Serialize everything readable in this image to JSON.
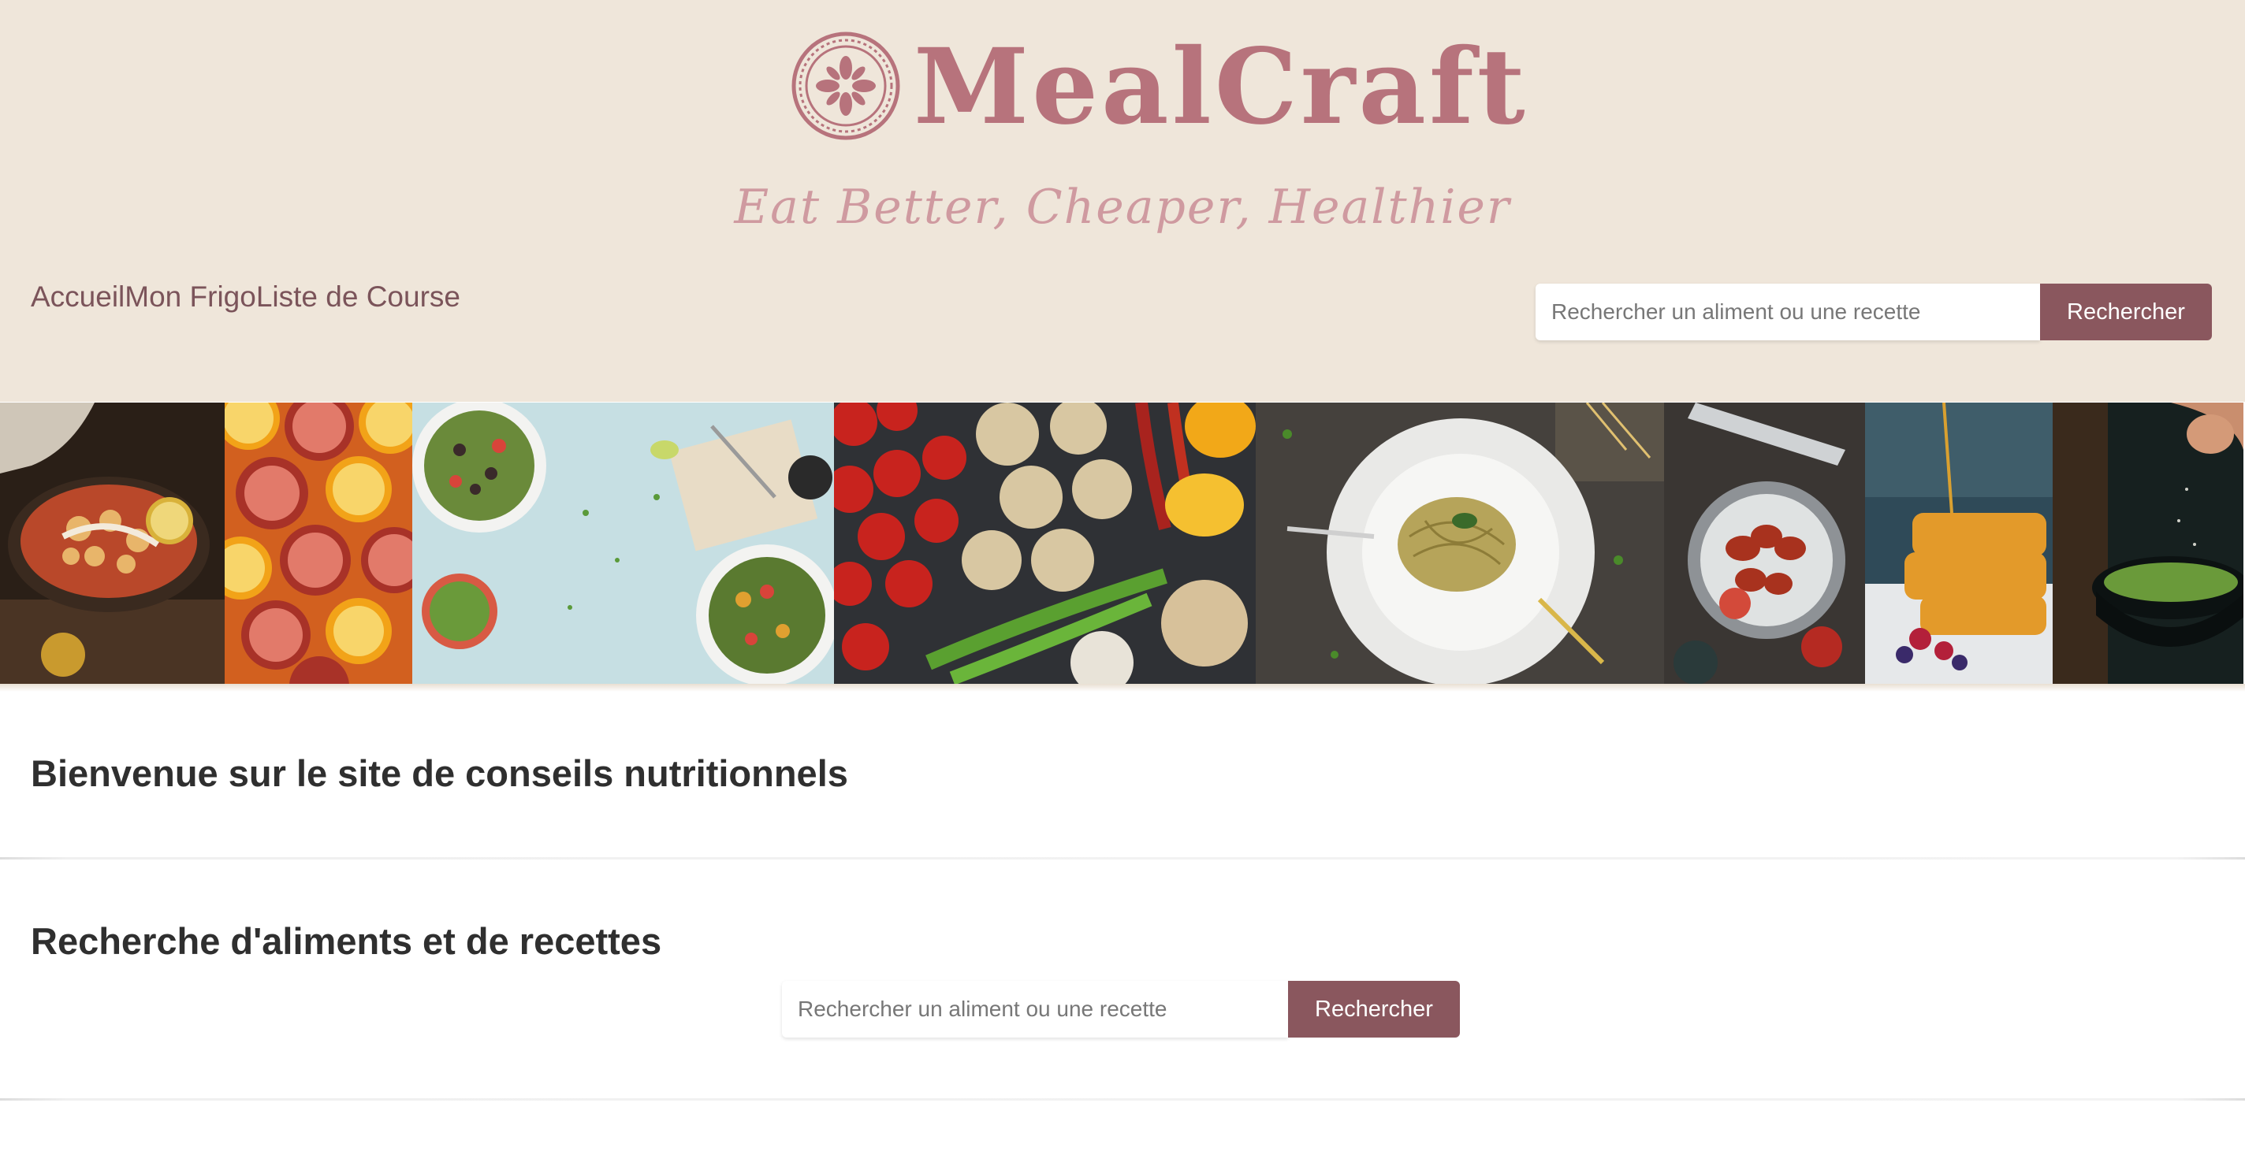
{
  "brand": {
    "name": "MealCraft",
    "tagline": "Eat Better, Cheaper, Healthier"
  },
  "nav": {
    "items": [
      {
        "label": "Accueil"
      },
      {
        "label": "Mon Frigo"
      },
      {
        "label": "Liste de Course"
      }
    ]
  },
  "header_search": {
    "placeholder": "Rechercher un aliment ou une recette",
    "value": "",
    "button_label": "Rechercher"
  },
  "banner": {
    "photos": [
      "curry-pan-photo",
      "pomegranate-grapefruit-photo",
      "salad-bowls-photo",
      "vegetables-photo",
      "pasta-plate-photo",
      "skewers-plate-photo",
      "waffles-berries-photo",
      "seasoning-bowl-photo"
    ]
  },
  "sections": {
    "welcome_title": "Bienvenue sur le site de conseils nutritionnels",
    "search_title": "Recherche d'aliments et de recettes"
  },
  "main_search": {
    "placeholder": "Rechercher un aliment ou une recette",
    "value": "",
    "button_label": "Rechercher"
  },
  "colors": {
    "header_bg": "#efe6da",
    "brand": "#b7737c",
    "nav_text": "#7b545a",
    "button_bg": "#8a575e"
  }
}
